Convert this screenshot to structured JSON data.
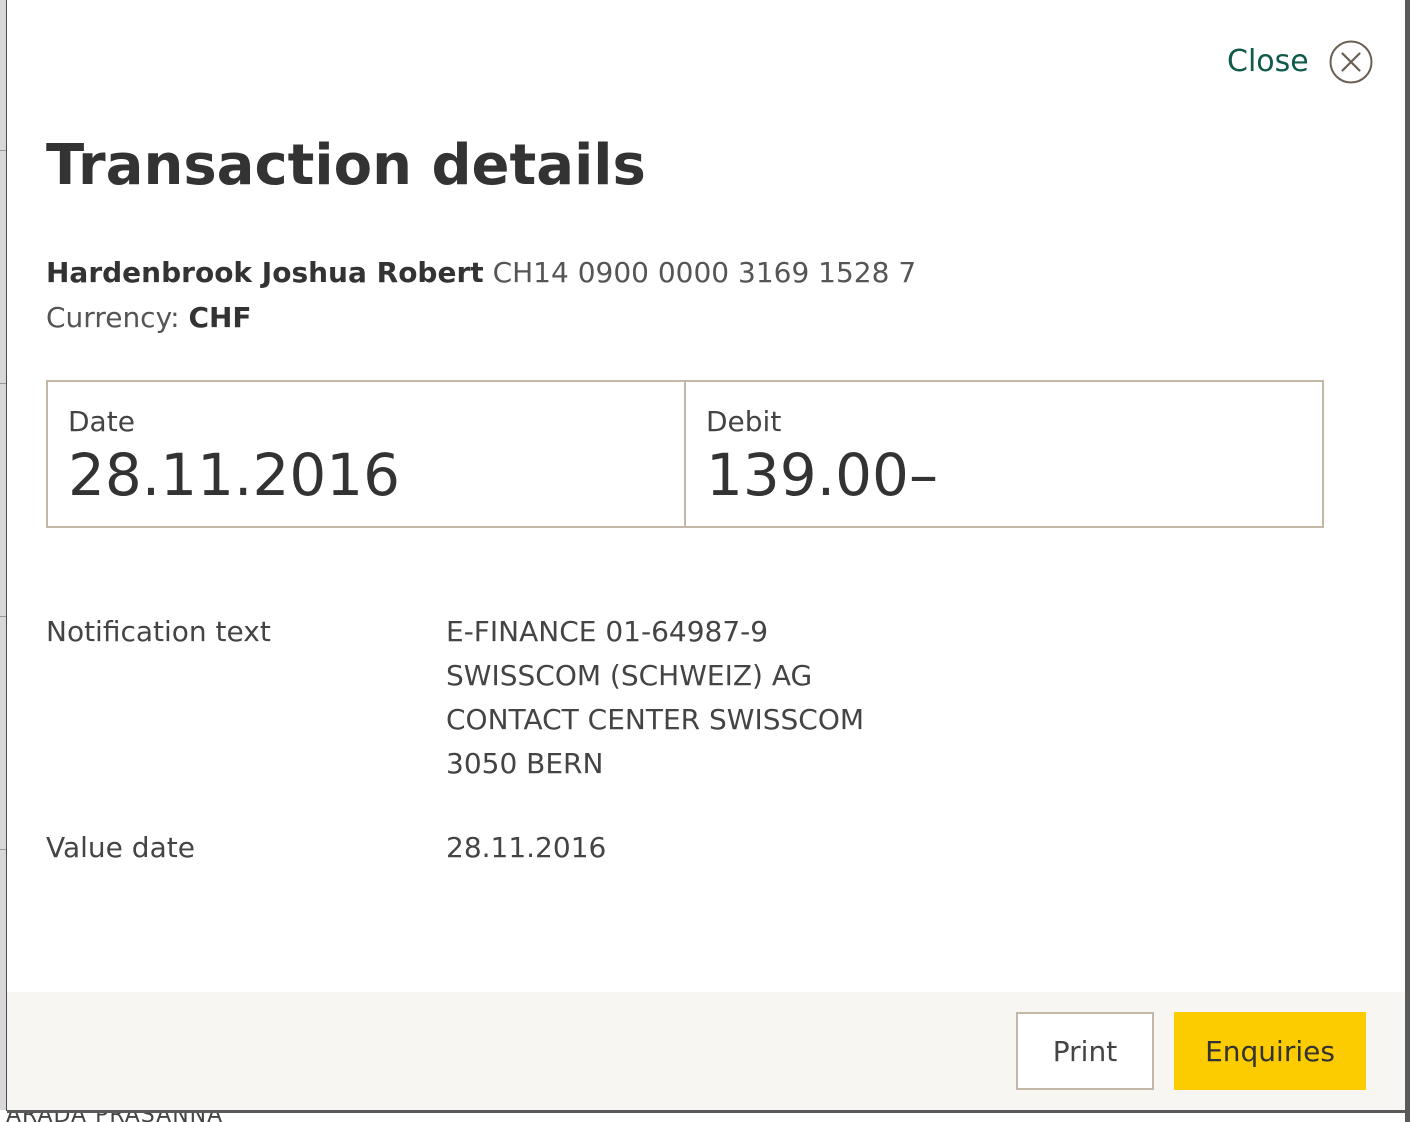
{
  "backdrop": {
    "partial_text": "ARADA PRASANNA"
  },
  "dialog": {
    "close_label": "Close",
    "close_icon": "close-circle-icon",
    "title": "Transaction details",
    "account": {
      "holder": "Hardenbrook Joshua Robert",
      "iban": "CH14 0900 0000 3169 1528 7"
    },
    "currency": {
      "label": "Currency:",
      "code": "CHF"
    },
    "summary": {
      "date_label": "Date",
      "date_value": "28.11.2016",
      "debit_label": "Debit",
      "debit_value": "139.00–"
    },
    "details": {
      "notification_label": "Notification text",
      "notification_lines": [
        "E-FINANCE 01-64987-9",
        "SWISSCOM (SCHWEIZ) AG",
        "CONTACT CENTER SWISSCOM",
        "3050 BERN"
      ],
      "value_date_label": "Value date",
      "value_date_value": "28.11.2016"
    },
    "footer": {
      "print_label": "Print",
      "enquiries_label": "Enquiries"
    }
  },
  "colors": {
    "accent_green": "#0f5a4a",
    "brand_yellow": "#fccc00",
    "border_beige": "#c3b8a8",
    "footer_bg": "#f8f6f2"
  }
}
